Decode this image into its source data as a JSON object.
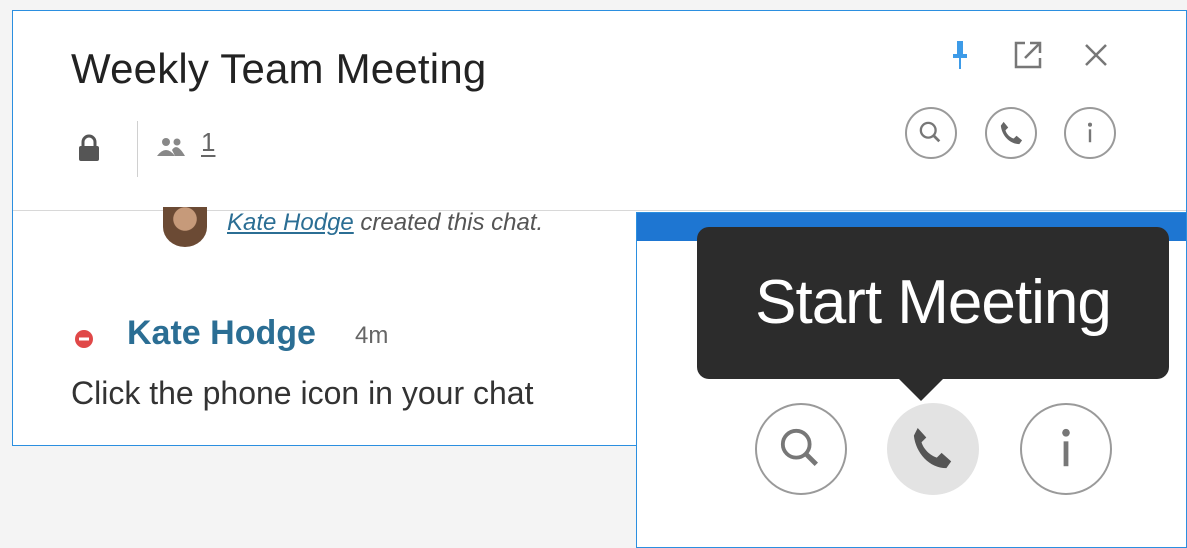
{
  "chat": {
    "title": "Weekly Team Meeting",
    "member_count": "1",
    "created_by": "Kate Hodge",
    "created_suffix": " created this chat.",
    "message": {
      "author": "Kate Hodge",
      "time": "4m",
      "text": "Click the phone icon in your chat"
    }
  },
  "header_actions": [
    "pin-icon",
    "popout-icon",
    "close-icon"
  ],
  "toolbar_icons": [
    "search-icon",
    "phone-icon",
    "info-icon"
  ],
  "zoom_callout": {
    "tooltip": "Start Meeting"
  },
  "colors": {
    "accent": "#2b8fe0",
    "author": "#2b6e94",
    "dnd": "#e04848",
    "tooltip_bg": "#2c2c2c"
  }
}
